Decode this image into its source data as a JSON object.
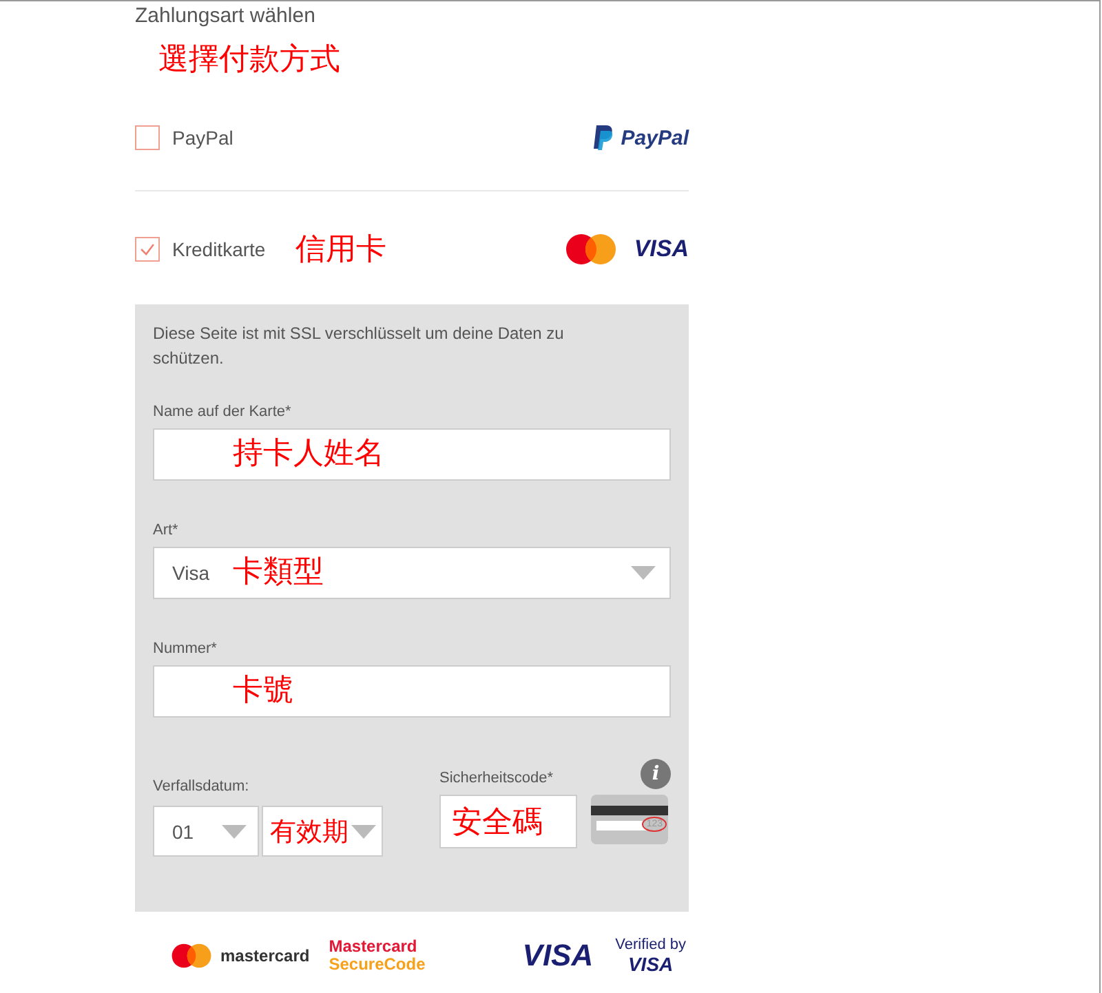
{
  "heading": "Zahlungsart wählen",
  "heading_note": "選擇付款方式",
  "methods": [
    {
      "kind": "paypal",
      "label": "PayPal",
      "checked": false,
      "logo_text": "PayPal"
    },
    {
      "kind": "card",
      "label": "Kreditkarte",
      "checked": true,
      "note": "信用卡",
      "logo_text": "VISA"
    }
  ],
  "card_form": {
    "notice": "Diese Seite ist mit SSL verschlüsselt um deine Daten zu schützen.",
    "fields": [
      {
        "kind": "text",
        "label": "Name auf der Karte*",
        "note": "持卡人姓名"
      },
      {
        "kind": "select",
        "label": "Art*",
        "value": "Visa",
        "note": "卡類型"
      },
      {
        "kind": "text",
        "label": "Nummer*",
        "note": "卡號"
      }
    ],
    "expiry": {
      "label": "Verfallsdatum:",
      "month": "01",
      "note": "有效期"
    },
    "security": {
      "label": "Sicherheitscode*",
      "note": "安全碼",
      "info": "i",
      "cvv_hint": "123"
    }
  },
  "footer": {
    "mastercard": "mastercard",
    "securecode": [
      "Mastercard",
      "SecureCode"
    ],
    "visa": "VISA",
    "verified": [
      "Verified by",
      "VISA"
    ]
  }
}
